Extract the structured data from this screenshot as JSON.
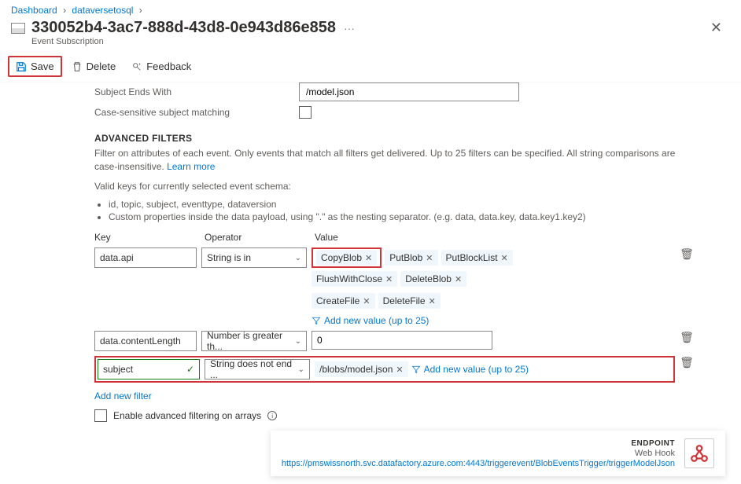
{
  "breadcrumb": {
    "a": "Dashboard",
    "b": "dataversetosql"
  },
  "header": {
    "title": "330052b4-3ac7-888d-43d8-0e943d86e858",
    "subtitle": "Event Subscription"
  },
  "toolbar": {
    "save": "Save",
    "delete": "Delete",
    "feedback": "Feedback"
  },
  "fields": {
    "subject_ends_with_label": "Subject Ends With",
    "subject_ends_with_value": "/model.json",
    "case_sensitive_label": "Case-sensitive subject matching"
  },
  "adv": {
    "title": "ADVANCED FILTERS",
    "desc": "Filter on attributes of each event. Only events that match all filters get delivered. Up to 25 filters can be specified. All string comparisons are case-insensitive.",
    "learn": "Learn more",
    "valid_keys_intro": "Valid keys for currently selected event schema:",
    "bullet1": "id, topic, subject, eventtype, dataversion",
    "bullet2": "Custom properties inside the data payload, using \".\" as the nesting separator. (e.g. data, data.key, data.key1.key2)",
    "col_key": "Key",
    "col_op": "Operator",
    "col_val": "Value",
    "add_value": "Add new value (up to 25)",
    "add_filter": "Add new filter",
    "enable_arrays": "Enable advanced filtering on arrays"
  },
  "filters": [
    {
      "key": "data.api",
      "operator": "String is in",
      "values": [
        "CopyBlob",
        "PutBlob",
        "PutBlockList",
        "FlushWithClose",
        "DeleteBlob",
        "CreateFile",
        "DeleteFile"
      ]
    },
    {
      "key": "data.contentLength",
      "operator": "Number is greater th...",
      "value_single": "0"
    },
    {
      "key": "subject",
      "operator": "String does not end ...",
      "values": [
        "/blobs/model.json"
      ],
      "key_valid": true
    }
  ],
  "endpoint": {
    "label": "ENDPOINT",
    "type": "Web Hook",
    "url": "https://pmswissnorth.svc.datafactory.azure.com:4443/triggerevent/BlobEventsTrigger/triggerModelJson"
  }
}
